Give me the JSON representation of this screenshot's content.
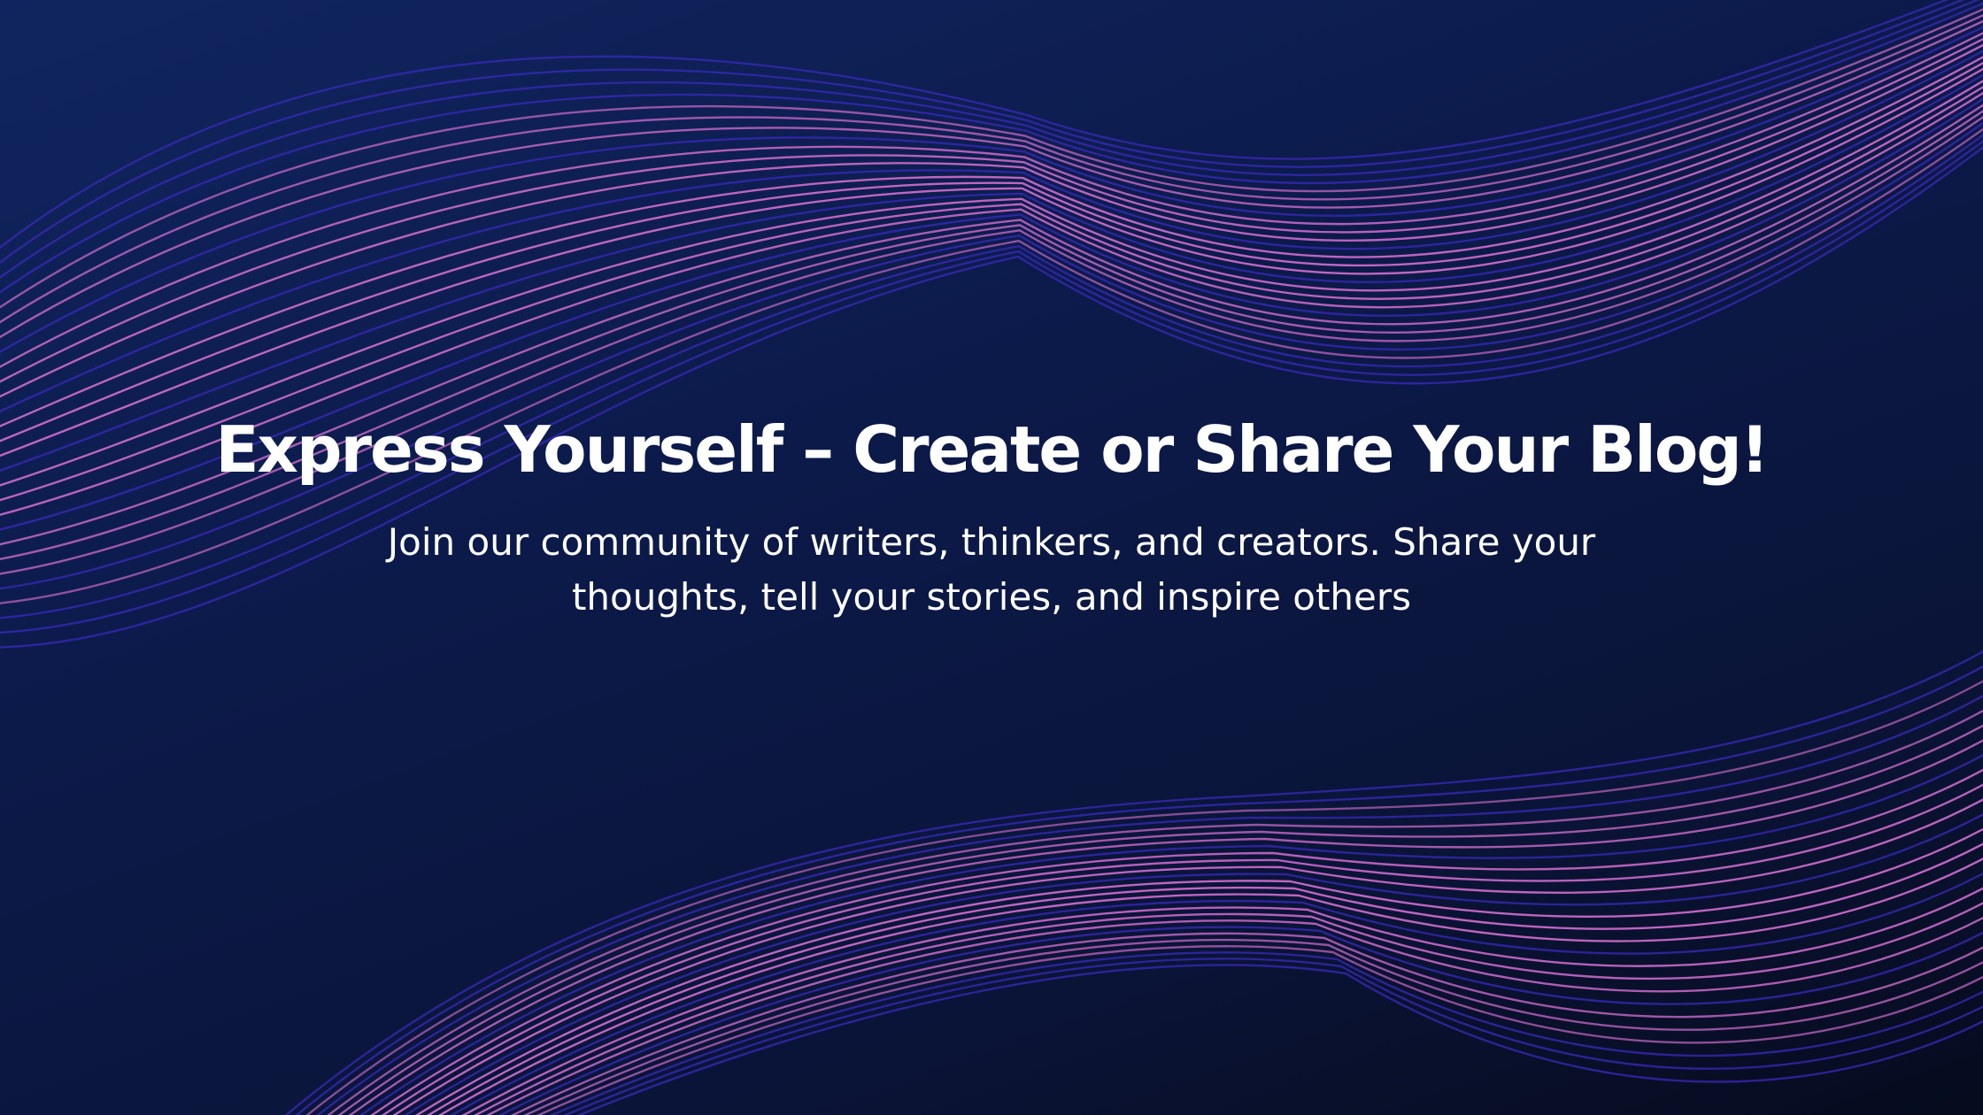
{
  "hero": {
    "headline": "Express Yourself – Create or Share Your Blog!",
    "subtext": "Join our community of writers, thinkers, and creators. Share your thoughts, tell your stories, and inspire others"
  },
  "theme": {
    "background_top": "#10255f",
    "background_bottom": "#060b1d",
    "wave_pink": "#c86ac8",
    "wave_blue": "#3a2ab8",
    "text_color": "#ffffff"
  }
}
